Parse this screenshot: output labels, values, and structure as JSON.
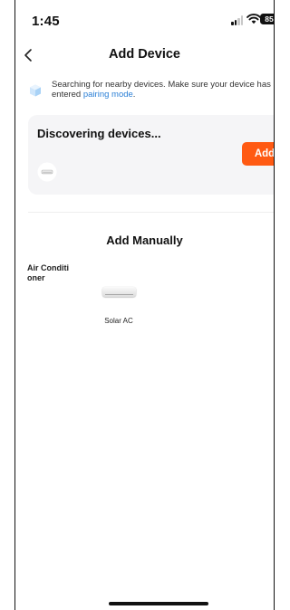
{
  "status_bar": {
    "time": "1:45",
    "battery": "85"
  },
  "nav": {
    "title": "Add Device",
    "back_icon": "chevron-left-icon",
    "scan_icon": "scan-icon"
  },
  "hint": {
    "text": "Searching for nearby devices. Make sure your device has entered ",
    "link": "pairing mode",
    "suffix": ".",
    "icon": "discovery-cube-icon"
  },
  "discovering": {
    "title": "Discovering devices...",
    "add_label": "Add",
    "device_icon": "air-conditioner-icon"
  },
  "manual": {
    "title": "Add Manually",
    "category": "Air Conditioner",
    "products": [
      {
        "name": "Solar AC",
        "icon": "air-conditioner-icon"
      }
    ]
  },
  "colors": {
    "accent": "#ff5a13",
    "link": "#2a7fd6",
    "card_bg": "#f5f5f7"
  }
}
